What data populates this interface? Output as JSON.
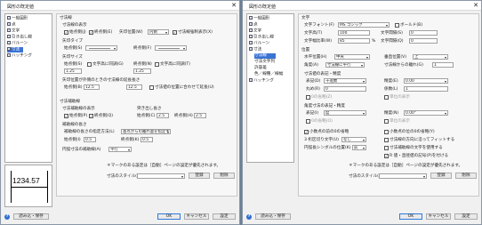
{
  "d1": {
    "title": "図形の既定値",
    "close": "✕",
    "tree": [
      "一般図形",
      "点",
      "文字",
      "引き出し線",
      "バルーン",
      "寸法",
      "ハッチング"
    ],
    "preview_text": "1234.57",
    "panel": {
      "g1_title": "寸法線",
      "g1a": "寸法線の表示",
      "start": "始点側(J)",
      "end": "終点側(E)",
      "arrow_pos": "矢印位置(W)",
      "arrow_pos_val": "内側",
      "dim_ext": "寸法線強制表示(X)",
      "arrow_type": "矢印タイプ",
      "start_side": "始点側(S)",
      "end_side": "終点側(F)",
      "arrow_size": "矢印サイズ",
      "start_side2": "始点側(S)",
      "end_side2": "終点側(N)",
      "text_h_adj": "文字高に同調(G)",
      "text_h_adj2": "文字高に同調(T)",
      "v1": "1.25",
      "v2": "1.25",
      "ext_len": "矢印位置が外側のときの寸法線の延長長さ",
      "start_b": "始点側(B)",
      "end_b": "終点側(D)",
      "v3": "12.5",
      "v4": "12.5",
      "fit_note": "寸法値の位置に合わせて延長(U)",
      "g2_title": "寸法補助線",
      "aux_show": "寸法補助線の表示",
      "start_p": "始点側(P)",
      "end_q": "終点側(Q)",
      "over_len": "突き出し長さ",
      "start_c": "始点側(C)",
      "end_h": "終点側(H)",
      "v5": "2.5",
      "v6": "2.5",
      "aux_len": "補助線の長さ",
      "aux_len_spec": "補助線の長さの指定方法(L)",
      "aux_len_val": "基点からの離れ量を指定する",
      "start_i": "始点側(I)",
      "end_k": "終点側(K)",
      "v7": "0.5",
      "v8": "0.5",
      "angle": "円弧寸法の補助線(A)",
      "angle_val": "平行",
      "star_note": "＊マークのある設定は［自動］ページの設定が優先されます。",
      "style": "寸法のスタイル(Z)",
      "register": "登録",
      "delete": "削除"
    },
    "import": "読み込・保存",
    "ok": "OK",
    "cancel": "キャンセル",
    "apply": "設定"
  },
  "d2": {
    "title": "図形の既定値",
    "close": "✕",
    "tree": [
      "一般図形",
      "点",
      "文字",
      "引き出し線",
      "バルーン",
      "寸法",
      "寸法線",
      "寸法文字列",
      "許容差",
      "色／線種／線幅",
      "ハッチング"
    ],
    "panel": {
      "text": "文字",
      "font": "文字フォント(F)",
      "font_val": "MS ゴシック",
      "bold": "ボールド(B)",
      "th": "文字高(T)",
      "th_val": "100",
      "ts": "文字間隔(S)",
      "ts_val": "0",
      "tw": "文字幅比率(W)",
      "tw_val": "85",
      "pct": "%",
      "lsp": "文字間隔(Q)",
      "lsp_val": "0",
      "pos": "位置",
      "hpos": "水平位置(H)",
      "hpos_val": "中央",
      "vpos": "垂直位置(V)",
      "vpos_val": "上",
      "angle": "角度(A)",
      "angle_val": "寸法線に平行",
      "gap": "寸法線からの離れ(G)",
      "gap_val": "1",
      "fmt": "寸法値の表記・精度",
      "notation": "表記(D)",
      "notation_val": "十進数",
      "prec": "精度(E)",
      "prec_val": "0.00",
      "round": "丸め(R)",
      "round_val": "0",
      "factor": "係数(L)",
      "factor_val": "1",
      "omit_lead": "0の省略(Z)",
      "unit": "単位の表示",
      "ang_fmt": "角度寸法の表記・精度",
      "ang_notation": "表記(I)",
      "ang_notation_val": "度",
      "ang_prec": "精度(N)",
      "ang_prec_val": "0.00°",
      "ang_omit": "0の省略(O)",
      "ang_unit": "単位の表示",
      "dec_sep": "小数点の前の0の省略",
      "c1": "小数点の位の0の省略(Y)",
      "c2": "寸法線の方向に沿ってフィットする",
      "deg_char": "3 桁区切り文字(U)",
      "deg_char_val": "なし",
      "c3": "寸法補助線の文字を使用する",
      "arc_sym": "円弧長シンボルの位置(K)",
      "arc_sym_val": "前",
      "c4": "R 値・直径値の記号(P)を付ける",
      "star_note": "＊マークのある設定は［自動］ページの設定が優先されます。",
      "style": "寸法のスタイル(Z)",
      "register": "登録",
      "delete": "削除"
    },
    "import": "読み込・保存",
    "ok": "OK",
    "cancel": "キャンセル",
    "apply": "設定"
  }
}
